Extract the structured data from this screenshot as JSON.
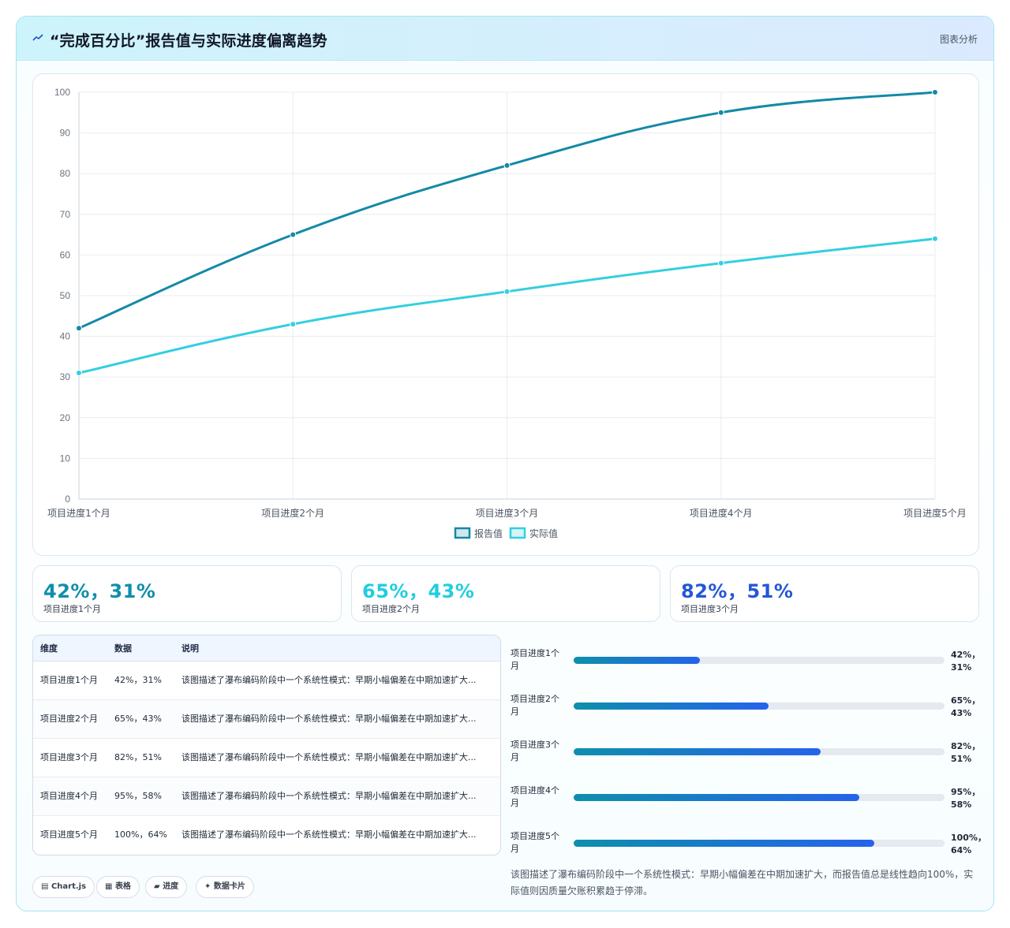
{
  "header": {
    "icon": "chart-spark-icon",
    "title": "“完成百分比”报告值与实际进度偏离趋势",
    "badge": "图表分析"
  },
  "chart_data": {
    "type": "line",
    "title": "",
    "xlabel": "",
    "ylabel": "",
    "categories": [
      "项目进度1个月",
      "项目进度2个月",
      "项目进度3个月",
      "项目进度4个月",
      "项目进度5个月"
    ],
    "series": [
      {
        "name": "报告值",
        "values": [
          42,
          65,
          82,
          95,
          100
        ],
        "color": "#1489a6"
      },
      {
        "name": "实际值",
        "values": [
          31,
          43,
          51,
          58,
          64
        ],
        "color": "#33cfe0"
      }
    ],
    "ylim": [
      0,
      100
    ],
    "yticks": [
      "0",
      "10",
      "20",
      "30",
      "40",
      "50",
      "60",
      "70",
      "80",
      "90",
      "100"
    ],
    "grid": true,
    "legend_position": "bottom"
  },
  "stats": [
    {
      "value": "42%，31%",
      "label": "项目进度1个月",
      "color": "#0e8fab"
    },
    {
      "value": "65%，43%",
      "label": "项目进度2个月",
      "color": "#22cde0"
    },
    {
      "value": "82%，51%",
      "label": "项目进度3个月",
      "color": "#2557d6"
    }
  ],
  "table": {
    "headers": [
      "维度",
      "数据",
      "说明"
    ],
    "rows": [
      {
        "dim": "项目进度1个月",
        "data": "42%，31%",
        "desc": "该图描述了瀑布编码阶段中一个系统性模式：早期小幅偏差在中期加速扩大..."
      },
      {
        "dim": "项目进度2个月",
        "data": "65%，43%",
        "desc": "该图描述了瀑布编码阶段中一个系统性模式：早期小幅偏差在中期加速扩大..."
      },
      {
        "dim": "项目进度3个月",
        "data": "82%，51%",
        "desc": "该图描述了瀑布编码阶段中一个系统性模式：早期小幅偏差在中期加速扩大..."
      },
      {
        "dim": "项目进度4个月",
        "data": "95%，58%",
        "desc": "该图描述了瀑布编码阶段中一个系统性模式：早期小幅偏差在中期加速扩大..."
      },
      {
        "dim": "项目进度5个月",
        "data": "100%，64%",
        "desc": "该图描述了瀑布编码阶段中一个系统性模式：早期小幅偏差在中期加速扩大..."
      }
    ]
  },
  "progress": [
    {
      "label": "项目进度1个月",
      "value": "42%，31%",
      "fill": 0.34
    },
    {
      "label": "项目进度2个月",
      "value": "65%，43%",
      "fill": 0.525
    },
    {
      "label": "项目进度3个月",
      "value": "82%，51%",
      "fill": 0.665
    },
    {
      "label": "项目进度4个月",
      "value": "95%，58%",
      "fill": 0.77
    },
    {
      "label": "项目进度5个月",
      "value": "100%，64%",
      "fill": 0.81
    }
  ],
  "summary": "该图描述了瀑布编码阶段中一个系统性模式：早期小幅偏差在中期加速扩大，而报告值总是线性趋向100%，实际值则因质量欠账积累趋于停滞。",
  "chips": [
    {
      "icon": "chart-icon",
      "glyph": "▤",
      "label": "Chart.js"
    },
    {
      "icon": "table-icon",
      "glyph": "▦",
      "label": "表格"
    },
    {
      "icon": "progress-icon",
      "glyph": "▰",
      "label": "进度"
    },
    {
      "icon": "sparkle-icon",
      "glyph": "✦",
      "label": "数据卡片"
    }
  ]
}
